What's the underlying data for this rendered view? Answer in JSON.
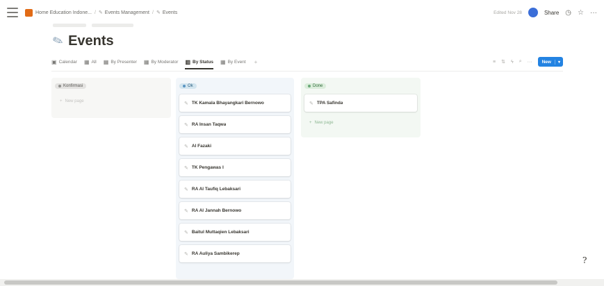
{
  "topbar": {
    "breadcrumbs": [
      "Home Education Indone...",
      "Events Management",
      "Events"
    ],
    "edited": "Edited Nov 28",
    "share_label": "Share"
  },
  "page": {
    "title": "Events"
  },
  "views": [
    {
      "label": "Calendar",
      "icon": "calendar-icon",
      "active": false
    },
    {
      "label": "All",
      "icon": "table-icon",
      "active": false
    },
    {
      "label": "By Presenter",
      "icon": "table-icon",
      "active": false
    },
    {
      "label": "By Moderator",
      "icon": "table-icon",
      "active": false
    },
    {
      "label": "By Status",
      "icon": "board-icon",
      "active": true
    },
    {
      "label": "By Event",
      "icon": "table-icon",
      "active": false
    }
  ],
  "toolbar": {
    "new_label": "New"
  },
  "board": {
    "columns": [
      {
        "status": "Konfirmasi",
        "count": "",
        "cards": [],
        "new_label": "New page"
      },
      {
        "status": "Ok",
        "count": "",
        "cards": [
          "TK Kamala Bhayangkari Bernowo",
          "RA Insan Taqwa",
          "Al Fazaki",
          "TK Pengawas I",
          "RA Al Taufiq Lebaksari",
          "RA Al Jannah Bernowo",
          "Baitul Muttaqien Lebaksari",
          "RA Auliya Sambikerep"
        ]
      },
      {
        "status": "Done",
        "count": "",
        "cards": [
          "TPA Safinda"
        ],
        "new_label": "New page"
      }
    ]
  },
  "colors": {
    "accent": "#2383e2",
    "status_konfirmasi": "#e3e2e0",
    "status_ok": "#d3e5ef",
    "status_done": "#dbeddb"
  }
}
